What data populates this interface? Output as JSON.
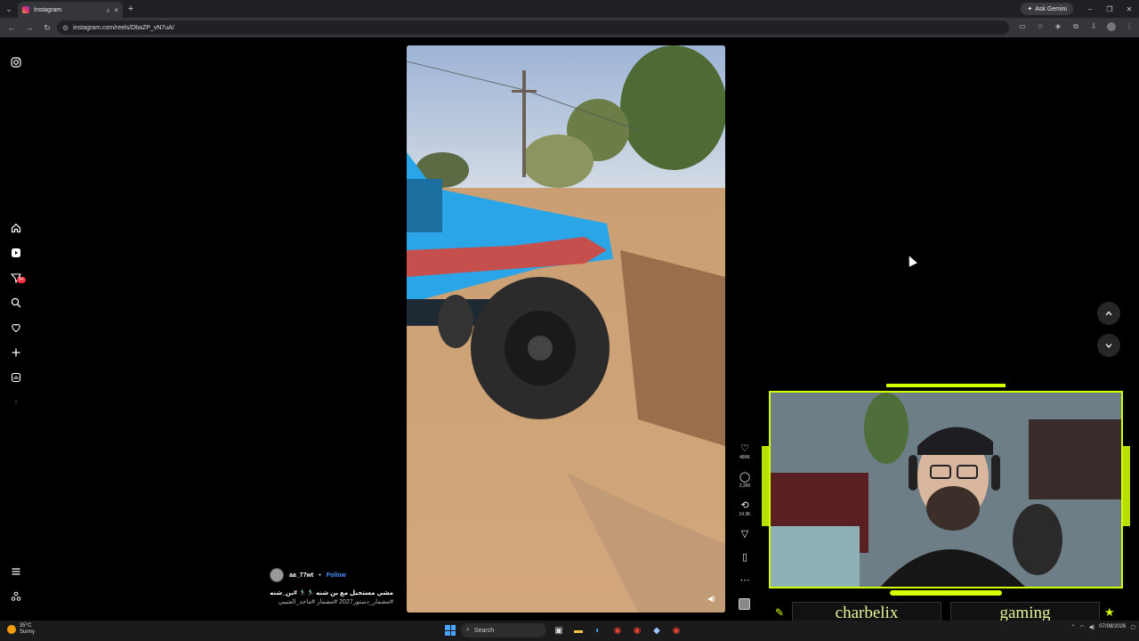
{
  "browser": {
    "tab_title": "Instagram",
    "url": "instagram.com/reels/DbaZP_vN7uA/",
    "gemini_label": "Ask Gemini",
    "new_tab_label": "+"
  },
  "sidebar": {
    "notification_badge": "9+"
  },
  "reel": {
    "username": "aa_77wt",
    "separator": "•",
    "follow_label": "Follow",
    "caption_line1": "مشي مستحيل مع بن شنه 🏃🏻‍♂️🏃🏻‍♂️ #بن_شنه",
    "caption_line2": "#مضمار_دستور2027 #مضمار #ماجد_العتيبي"
  },
  "actions": {
    "likes": "486K",
    "comments": "3,390",
    "reposts": "14.3K"
  },
  "overlay": {
    "name_left": "charbelix",
    "name_right": "gaming",
    "accent_color": "#d2ff00"
  },
  "taskbar": {
    "temperature": "35°C",
    "weather": "Sunny",
    "search_label": "Search",
    "date": "07/08/2026"
  }
}
